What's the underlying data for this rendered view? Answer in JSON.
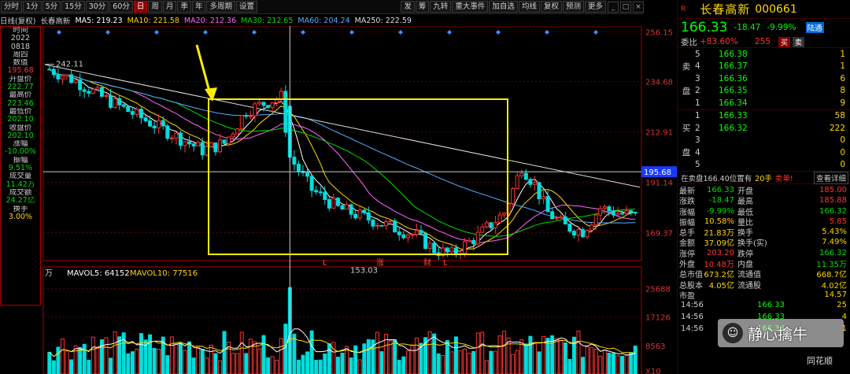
{
  "toolbar": {
    "items": [
      "分时",
      "1分",
      "5分",
      "15分",
      "30分",
      "60分",
      "日",
      "周",
      "月",
      "季",
      "年",
      "多周期",
      "设置"
    ],
    "active_index": 6,
    "right_items": [
      "发",
      "筹",
      "九转",
      "重大事件",
      "加自选",
      "均线",
      "复权",
      "预测",
      "更多"
    ]
  },
  "legend": {
    "period": "日线(复权)",
    "name": "长春高新",
    "ma": [
      {
        "label": "MA5: 219.23",
        "color": "#ffffff"
      },
      {
        "label": "MA10: 221.58",
        "color": "#ffd700"
      },
      {
        "label": "MA20: 212.36",
        "color": "#ff66ff"
      },
      {
        "label": "MA30: 212.65",
        "color": "#00dd00"
      },
      {
        "label": "MA60: 204.24",
        "color": "#55aaff"
      },
      {
        "label": "MA250: 222.59",
        "color": "#dddddd"
      }
    ]
  },
  "left_panel": [
    {
      "t": "时间",
      "c": "#cccccc"
    },
    {
      "t": "2022",
      "c": "#cccccc"
    },
    {
      "t": "0818",
      "c": "#cccccc"
    },
    {
      "t": "周四",
      "c": "#cccccc"
    },
    {
      "t": "数值",
      "c": "#cccccc"
    },
    {
      "t": "195.68",
      "c": "#ff3333"
    },
    {
      "t": "开盘价",
      "c": "#cccccc"
    },
    {
      "t": "222.77",
      "c": "#00dd00"
    },
    {
      "t": "最高价",
      "c": "#cccccc"
    },
    {
      "t": "223.46",
      "c": "#00dd00"
    },
    {
      "t": "最低价",
      "c": "#cccccc"
    },
    {
      "t": "202.10",
      "c": "#00dd00"
    },
    {
      "t": "收盘价",
      "c": "#cccccc"
    },
    {
      "t": "202.10",
      "c": "#00dd00"
    },
    {
      "t": "涨幅",
      "c": "#cccccc"
    },
    {
      "t": "-10.00%",
      "c": "#00dd00"
    },
    {
      "t": "振幅",
      "c": "#cccccc"
    },
    {
      "t": "9.51%",
      "c": "#00dd00"
    },
    {
      "t": "成交量",
      "c": "#cccccc"
    },
    {
      "t": "11.42万",
      "c": "#00dd00"
    },
    {
      "t": "成交额",
      "c": "#cccccc"
    },
    {
      "t": "24.27亿",
      "c": "#00dd00"
    },
    {
      "t": "换手",
      "c": "#cccccc"
    },
    {
      "t": "3.00%",
      "c": "#ffd700"
    }
  ],
  "chart_data": {
    "type": "candlestick",
    "price_axis": {
      "ylim": [
        160,
        258
      ],
      "ticks": [
        "256.15",
        "234.68",
        "212.91",
        "191.14",
        "169.37"
      ],
      "marker": "195.68"
    },
    "volume_axis": {
      "ylim": [
        0,
        27000
      ],
      "ticks": [
        "25688",
        "17126",
        "8563",
        "X10"
      ]
    },
    "annotations": {
      "high_label": "242.11",
      "low_label": "153.03",
      "markers": [
        "L",
        "涨",
        "财",
        "L"
      ]
    },
    "volume_legend": {
      "unit": "万",
      "mavol5": "MAVOL5: 64152",
      "mavol10": "MAVOL10: 77516"
    },
    "note": "approx 135 daily candles"
  },
  "quote": {
    "r_mark": "R",
    "name": "长春高新",
    "code": "000661",
    "price": "166.33",
    "change": "-18.47",
    "pct": "-9.99%",
    "badge": "陆通",
    "wb_label": "委比",
    "wb_value": "+83.60%",
    "wb_num": "255",
    "buy": "买",
    "sell": "卖",
    "sell_side": [
      "卖",
      "盘"
    ],
    "buy_side": [
      "买",
      "盘"
    ],
    "sells": [
      {
        "lvl": "5",
        "p": "166.38",
        "v": "1"
      },
      {
        "lvl": "4",
        "p": "166.37",
        "v": "1"
      },
      {
        "lvl": "3",
        "p": "166.36",
        "v": "6"
      },
      {
        "lvl": "2",
        "p": "166.35",
        "v": "8"
      },
      {
        "lvl": "1",
        "p": "166.34",
        "v": "9"
      }
    ],
    "buys": [
      {
        "lvl": "1",
        "p": "166.33",
        "v": "58"
      },
      {
        "lvl": "2",
        "p": "166.32",
        "v": "222"
      },
      {
        "lvl": "3",
        "p": "",
        "v": "0"
      },
      {
        "lvl": "4",
        "p": "",
        "v": "0"
      },
      {
        "lvl": "5",
        "p": "",
        "v": "0"
      }
    ],
    "bar": {
      "a": "在卖盘166.40位置有",
      "b": "20手",
      "c": "卖单!",
      "d": "查看详细"
    },
    "stats": [
      {
        "k": "最新",
        "v": "166.33",
        "vc": "#00dd00",
        "k2": "开盘",
        "v2": "185.00",
        "v2c": "#ff3333"
      },
      {
        "k": "涨跌",
        "v": "-18.47",
        "vc": "#00dd00",
        "k2": "最高",
        "v2": "185.88",
        "v2c": "#ff3333"
      },
      {
        "k": "涨幅",
        "v": "-9.99%",
        "vc": "#00dd00",
        "k2": "最低",
        "v2": "166.32",
        "v2c": "#00dd00"
      },
      {
        "k": "振幅",
        "v": "10.58%",
        "vc": "#ffd700",
        "k2": "量比",
        "v2": "5.85",
        "v2c": "#ff3333"
      },
      {
        "k": "总手",
        "v": "21.83万",
        "vc": "#ffd700",
        "k2": "换手",
        "v2": "5.43%",
        "v2c": "#ffd700"
      },
      {
        "k": "金额",
        "v": "37.09亿",
        "vc": "#ffd700",
        "k2": "换手(实)",
        "v2": "7.49%",
        "v2c": "#ffd700"
      },
      {
        "k": "涨停",
        "v": "203.20",
        "vc": "#ff3333",
        "k2": "跌停",
        "v2": "166.32",
        "v2c": "#00dd00"
      },
      {
        "k": "外盘",
        "v": "10.48万",
        "vc": "#ff3333",
        "k2": "内盘",
        "v2": "11.35万",
        "v2c": "#00dd00"
      },
      {
        "k": "总市值",
        "v": "673.2亿",
        "vc": "#ffd700",
        "k2": "流通值",
        "v2": "668.7亿",
        "v2c": "#ffd700"
      },
      {
        "k": "总股本",
        "v": "4.05亿",
        "vc": "#ffd700",
        "k2": "流通股",
        "v2": "4.02亿",
        "v2c": "#ffd700"
      },
      {
        "k": "市盈",
        "v": "",
        "vc": "#ffd700",
        "k2": "",
        "v2": "14.57",
        "v2c": "#ffd700"
      }
    ],
    "trades": [
      {
        "t": "14:56",
        "p": "166.33",
        "v": "25"
      },
      {
        "t": "14:56",
        "p": "166.33",
        "v": "4"
      },
      {
        "t": "14:56",
        "p": "166.34",
        "v": "1"
      }
    ]
  },
  "watermark": {
    "icon": "WeChat-icon",
    "text": "静心擒牛"
  },
  "logo2": "同花顺"
}
